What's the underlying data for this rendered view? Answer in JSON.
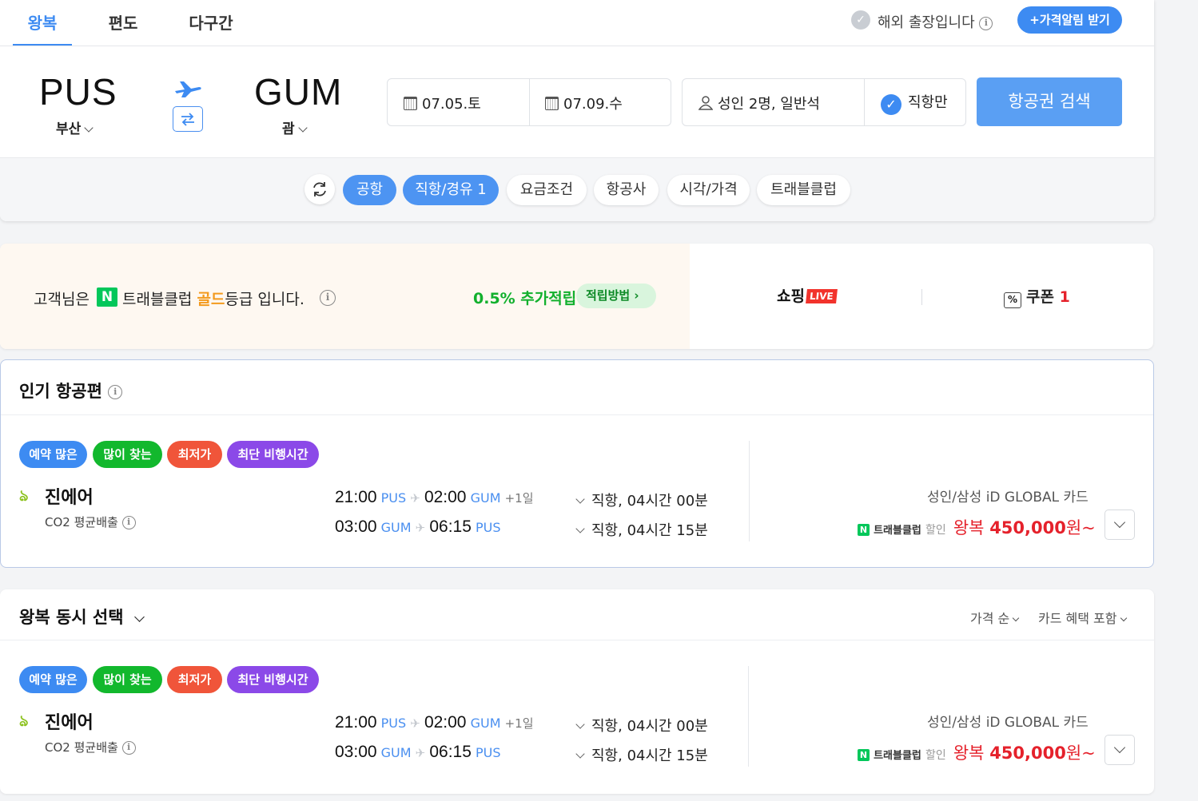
{
  "trip_tabs": [
    {
      "label": "왕복",
      "active": true
    },
    {
      "label": "편도",
      "active": false
    },
    {
      "label": "다구간",
      "active": false
    }
  ],
  "business_trip": {
    "label": "해외 출장입니다"
  },
  "price_alert": {
    "label": "+가격알림 받기"
  },
  "route": {
    "origin": {
      "code": "PUS",
      "city": "부산"
    },
    "destination": {
      "code": "GUM",
      "city": "괌"
    }
  },
  "dates": {
    "depart": "07.05.토",
    "return": "07.09.수"
  },
  "passengers": {
    "label": "성인 2명, 일반석"
  },
  "direct_only": {
    "label": "직항만",
    "checked": true
  },
  "search_button": {
    "label": "항공권 검색"
  },
  "filters": [
    {
      "label": "공항",
      "active": true
    },
    {
      "label": "직항/경유 1",
      "active": true
    },
    {
      "label": "요금조건",
      "active": false
    },
    {
      "label": "항공사",
      "active": false
    },
    {
      "label": "시각/가격",
      "active": false
    },
    {
      "label": "트래블클럽",
      "active": false
    }
  ],
  "promo": {
    "prefix": "고객님은",
    "n_badge": "N",
    "club": "트래블클럽",
    "grade": "골드",
    "suffix": "등급 입니다.",
    "extra": "0.5% 추가적립",
    "how_button": "적립방법",
    "shopping": "쇼핑",
    "live_badge": "LIVE",
    "coupon_label": "쿠폰",
    "coupon_count": "1"
  },
  "popular": {
    "title": "인기 항공편",
    "card": {
      "tags": [
        "예약 많은",
        "많이 찾는",
        "최저가",
        "최단 비행시간"
      ],
      "airline": "진에어",
      "co2": "CO2 평균배출",
      "legs": [
        {
          "dep_time": "21:00",
          "dep_apt": "PUS",
          "arr_time": "02:00",
          "arr_apt": "GUM",
          "plus": "+1일",
          "info": "직항, 04시간 00분"
        },
        {
          "dep_time": "03:00",
          "dep_apt": "GUM",
          "arr_time": "06:15",
          "arr_apt": "PUS",
          "plus": "",
          "info": "직항, 04시간 15분"
        }
      ],
      "card_label": "성인/삼성 iD GLOBAL 카드",
      "tc_label": "트래블클럽",
      "tc_disc": "할인",
      "price_prefix": "왕복",
      "price": "450,000",
      "price_suffix": "원~"
    }
  },
  "round_select": {
    "title": "왕복 동시 선택",
    "sort1": "가격 순",
    "sort2": "카드 혜택 포함",
    "card": {
      "tags": [
        "예약 많은",
        "많이 찾는",
        "최저가",
        "최단 비행시간"
      ],
      "airline": "진에어",
      "co2": "CO2 평균배출",
      "legs": [
        {
          "dep_time": "21:00",
          "dep_apt": "PUS",
          "arr_time": "02:00",
          "arr_apt": "GUM",
          "plus": "+1일",
          "info": "직항, 04시간 00분"
        },
        {
          "dep_time": "03:00",
          "dep_apt": "GUM",
          "arr_time": "06:15",
          "arr_apt": "PUS",
          "plus": "",
          "info": "직항, 04시간 15분"
        }
      ],
      "card_label": "성인/삼성 iD GLOBAL 카드",
      "tc_label": "트래블클럽",
      "tc_disc": "할인",
      "price_prefix": "왕복",
      "price": "450,000",
      "price_suffix": "원~"
    }
  },
  "colors": {
    "accent": "#3d8bf2",
    "price_red": "#e5212b",
    "naver_green": "#03c75a",
    "gold": "#f39a1e"
  }
}
